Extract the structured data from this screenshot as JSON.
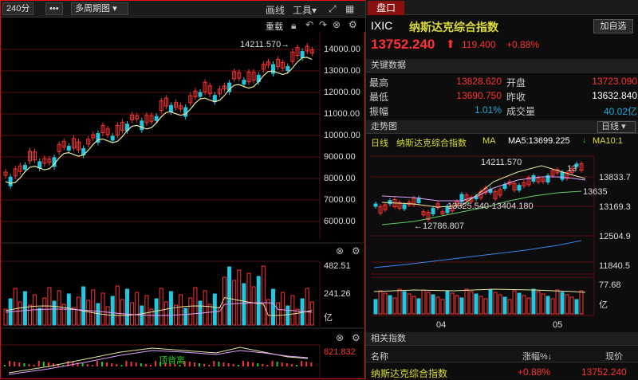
{
  "toolbar": {
    "period": "240分",
    "more": "•••",
    "multi": "多周期图",
    "draw": "画线",
    "tools": "工具",
    "tab": "盘口"
  },
  "kline": {
    "restore_label": "重载",
    "high_label": "14211.570→",
    "yticks": [
      "14000.00",
      "13000.00",
      "12000.00",
      "11000.00",
      "10000.00",
      "9000.00",
      "8000.00",
      "7000.00",
      "6000.00"
    ]
  },
  "volume": {
    "ticks": [
      "482.51",
      "241.26",
      "亿"
    ]
  },
  "macd": {
    "tick": "821.832",
    "label": "顶背离"
  },
  "quote": {
    "code": "IXIC",
    "name": "纳斯达克综合指数",
    "add": "加自选",
    "price": "13752.240",
    "change": "119.400",
    "pct": "+0.88%"
  },
  "key": {
    "title": "关键数据",
    "high_l": "最高",
    "high": "13828.620",
    "open_l": "开盘",
    "open": "13723.090",
    "low_l": "最低",
    "low": "13690.750",
    "prev_l": "昨收",
    "prev": "13632.840",
    "amp_l": "振幅",
    "amp": "1.01%",
    "vol_l": "成交量",
    "vol": "40.02亿"
  },
  "trend": {
    "title": "走势图",
    "period": "日线",
    "legend_day": "日线",
    "legend_name": "纳斯达克综合指数",
    "ma": "MA",
    "ma5": "MA5:13699.225",
    "ma10": "MA10:1",
    "hi": "14211.570",
    "n13": "13",
    "lo_range": "13325.540-13404.180",
    "lo": "←12786.807",
    "cur": "13635",
    "yticks": [
      "13833.7",
      "13169.3",
      "12504.9",
      "11840.5"
    ],
    "vol_top": "77.68",
    "vol_unit": "亿",
    "xticks": [
      "04",
      "05"
    ]
  },
  "related": {
    "title": "相关指数",
    "col_name": "名称",
    "col_pct": "涨幅%↓",
    "col_price": "现价",
    "row_name": "纳斯达克综合指数",
    "row_pct": "+0.88%",
    "row_price": "13752.240"
  },
  "colors": {
    "up": "#ff3333",
    "down": "#22c8e0",
    "ma5": "#e8e8a0",
    "ma10": "#e0a0ff",
    "panel_border": "#dd1111"
  }
}
